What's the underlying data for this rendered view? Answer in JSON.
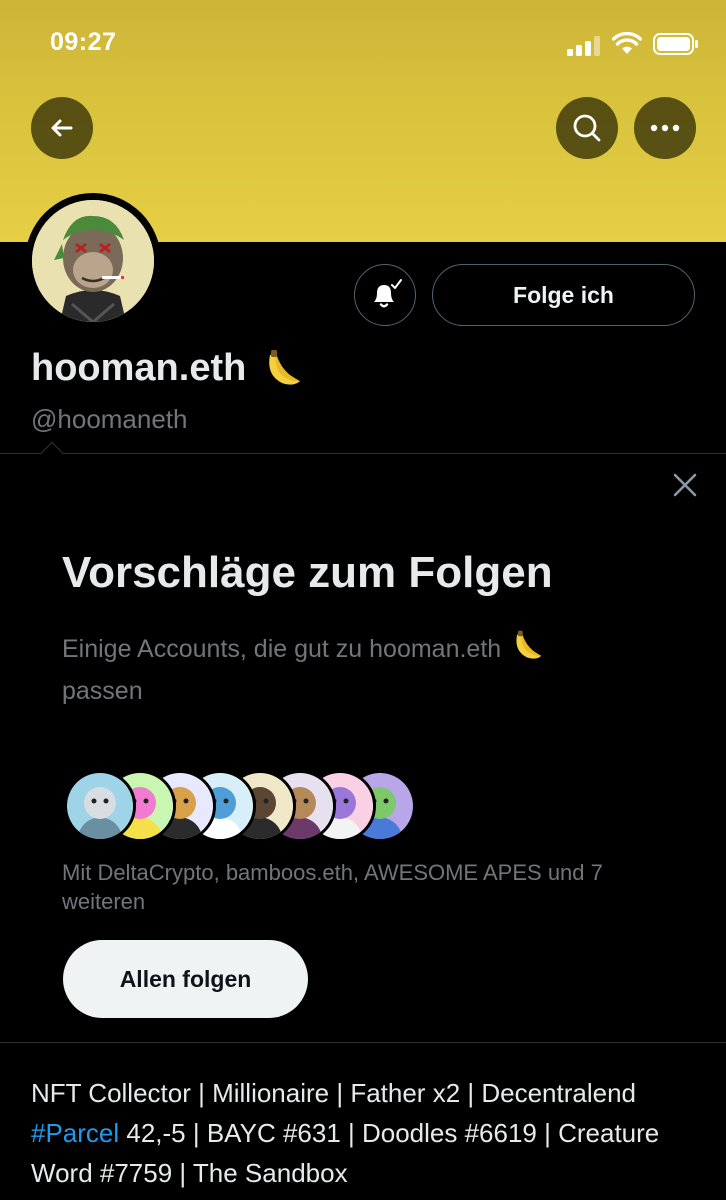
{
  "status_bar": {
    "time": "09:27"
  },
  "profile": {
    "display_name": "hooman.eth",
    "name_emoji": "banana-icon",
    "handle": "@hoomaneth",
    "follow_button_label": "Folge ich",
    "notification_icon": "bell-check-icon"
  },
  "suggestions": {
    "title": "Vorschläge zum Folgen",
    "subtitle_line1": "Einige Accounts, die gut zu hooman.eth",
    "subtitle_line2": "passen",
    "with_text": "Mit DeltaCrypto, bamboos.eth, AWESOME APES und 7 weiteren",
    "follow_all_label": "Allen folgen",
    "avatar_count": 8
  },
  "bio": {
    "part1": "NFT Collector | Millionaire | Father x2 | Decentralend ",
    "hashtag": "#Parcel",
    "part2": " 42,-5 | BAYC #631 | Doodles #6619 | Creature Word #7759 | The Sandbox"
  },
  "colors": {
    "banner": "#d9c33d",
    "accent_link": "#1d9bf0",
    "muted_text": "#71767b",
    "background": "#000000"
  }
}
